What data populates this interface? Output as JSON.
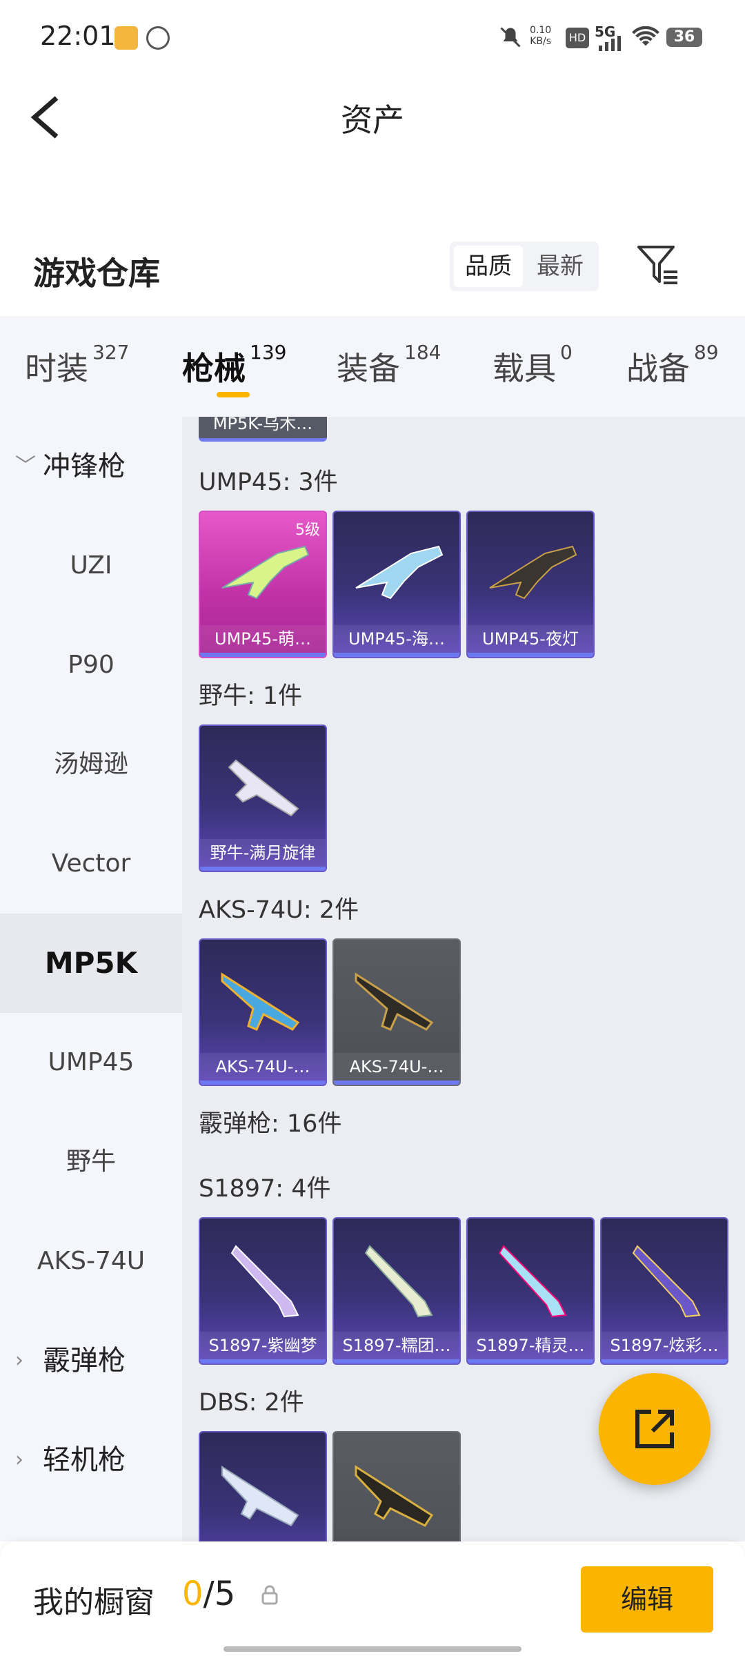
{
  "status_bar": {
    "time": "22:01",
    "net_speed_value": "0.10",
    "net_speed_unit": "KB/s",
    "hd": "HD",
    "network": "5G",
    "battery": "36"
  },
  "header": {
    "title": "资产"
  },
  "warehouse": {
    "title": "游戏仓库",
    "sort_options": [
      "品质",
      "最新"
    ],
    "sort_selected": "品质"
  },
  "tabs": [
    {
      "label": "时装",
      "count": "327"
    },
    {
      "label": "枪械",
      "count": "139",
      "active": true
    },
    {
      "label": "装备",
      "count": "184"
    },
    {
      "label": "载具",
      "count": "0"
    },
    {
      "label": "战备",
      "count": "89"
    }
  ],
  "sidebar": [
    {
      "label": "冲锋枪",
      "type": "group",
      "expanded": true
    },
    {
      "label": "UZI"
    },
    {
      "label": "P90"
    },
    {
      "label": "汤姆逊"
    },
    {
      "label": "Vector"
    },
    {
      "label": "MP5K",
      "selected": true
    },
    {
      "label": "UMP45"
    },
    {
      "label": "野牛"
    },
    {
      "label": "AKS-74U"
    },
    {
      "label": "霰弹枪",
      "type": "group",
      "expanded": false
    },
    {
      "label": "轻机枪",
      "type": "group",
      "expanded": false
    }
  ],
  "content": {
    "partial_card": "MP5K-乌木…",
    "sections": [
      {
        "title": "UMP45: 3件",
        "cards": [
          {
            "name": "UMP45-萌…",
            "level": "5级",
            "style": "pink"
          },
          {
            "name": "UMP45-海…",
            "style": "purple"
          },
          {
            "name": "UMP45-夜灯",
            "style": "purple"
          }
        ]
      },
      {
        "title": "野牛: 1件",
        "cards": [
          {
            "name": "野牛-满月旋律",
            "style": "purple"
          }
        ]
      },
      {
        "title": "AKS-74U: 2件",
        "cards": [
          {
            "name": "AKS-74U-…",
            "style": "purple"
          },
          {
            "name": "AKS-74U-…",
            "style": "grey"
          }
        ]
      },
      {
        "title": "霰弹枪: 16件",
        "cards": []
      },
      {
        "title": "S1897: 4件",
        "cards": [
          {
            "name": "S1897-紫幽梦",
            "style": "purple"
          },
          {
            "name": "S1897-糯团…",
            "style": "purple"
          },
          {
            "name": "S1897-精灵…",
            "style": "purple"
          },
          {
            "name": "S1897-炫彩…",
            "style": "purple"
          }
        ]
      },
      {
        "title": "DBS: 2件",
        "cards": [
          {
            "name": "",
            "style": "purple"
          },
          {
            "name": "",
            "style": "grey"
          }
        ]
      }
    ]
  },
  "bottom": {
    "label": "我的橱窗",
    "count_current": "0",
    "count_total": "/5",
    "edit_label": "编辑"
  },
  "colors": {
    "accent": "#fbb500",
    "tab_bg": "#f4f6fb"
  }
}
